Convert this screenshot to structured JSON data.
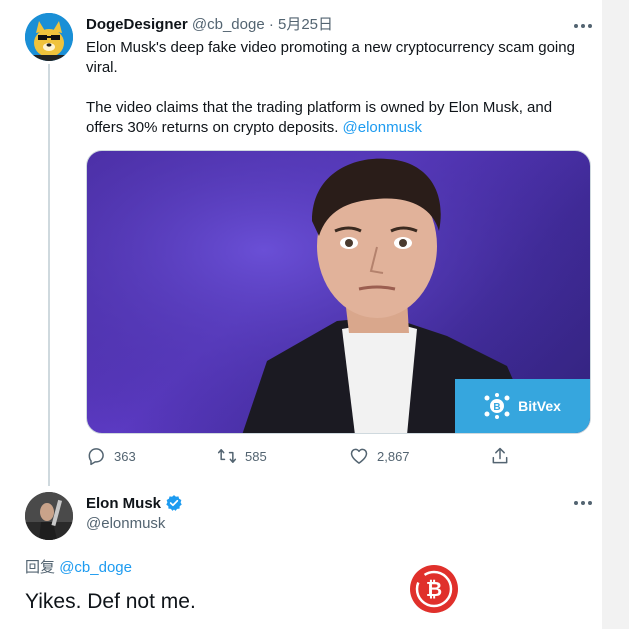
{
  "tweet": {
    "author_name": "DogeDesigner",
    "author_handle": "@cb_doge",
    "separator": "·",
    "date": "5月25日",
    "text_line1": "Elon Musk's deep fake video promoting a new cryptocurrency scam going viral.",
    "text_line2": "The video claims that the trading platform is owned by Elon Musk, and offers 30% returns on crypto deposits.",
    "mention": "@elonmusk",
    "media_brand": "BitVex",
    "stats": {
      "replies": "363",
      "retweets": "585",
      "likes": "2,867"
    }
  },
  "reply": {
    "author_name": "Elon Musk",
    "author_handle": "@elonmusk",
    "reply_prefix": "回复",
    "reply_to": "@cb_doge",
    "text": "Yikes. Def not me."
  },
  "icons": [
    "more-icon",
    "reply-icon",
    "retweet-icon",
    "like-icon",
    "share-icon",
    "verified-icon",
    "bitvex-logo-icon",
    "bitcoin-watermark-icon"
  ],
  "colors": {
    "accent": "#1d9bf0",
    "secondary_text": "#536471",
    "bitvex_blue": "#36a6de",
    "watermark_red": "#e0302b"
  }
}
